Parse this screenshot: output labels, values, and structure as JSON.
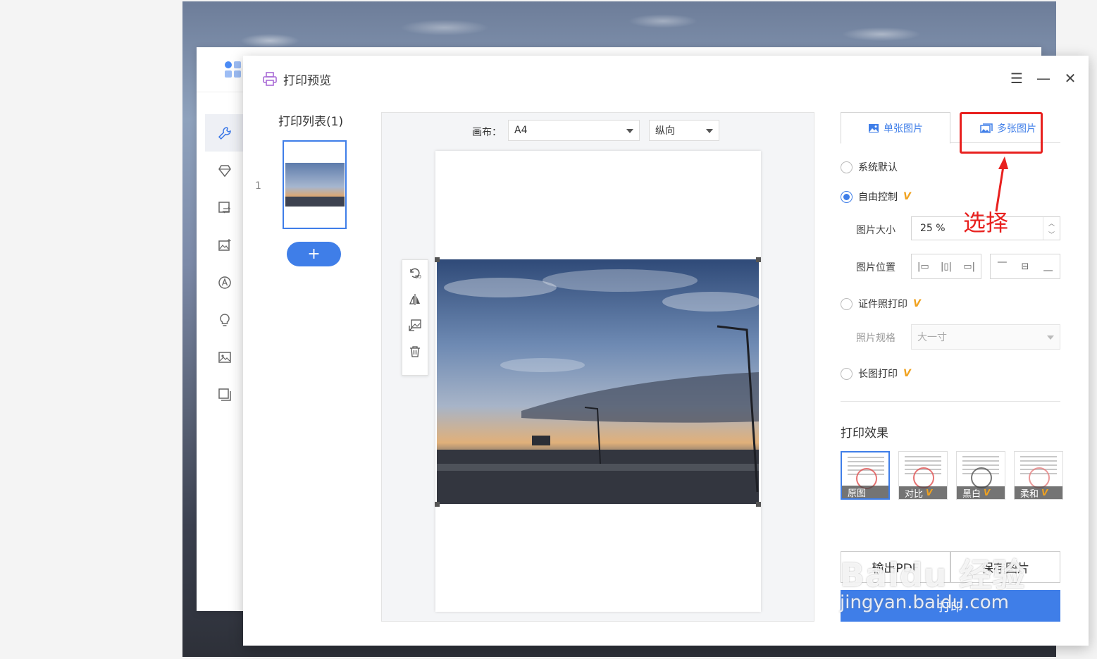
{
  "dialog": {
    "title": "打印预览",
    "controls": {
      "menu": "☰",
      "minimize": "—",
      "close": "✕"
    }
  },
  "print_list": {
    "title": "打印列表(1)",
    "item_index": "1",
    "add_label": "+"
  },
  "preview": {
    "canvas_label": "画布：",
    "paper_size": "A4",
    "orientation": "纵向",
    "tools": [
      "rotate-90-icon",
      "flip-icon",
      "replace-image-icon",
      "delete-icon"
    ]
  },
  "panel": {
    "tabs": {
      "single": "单张图片",
      "multi": "多张图片"
    },
    "options": {
      "system_default": "系统默认",
      "free_control": "自由控制",
      "id_photo": "证件照打印",
      "long_image": "长图打印"
    },
    "vip_mark": "V",
    "image_size_label": "图片大小",
    "image_size_value": "25 %",
    "image_position_label": "图片位置",
    "photo_spec_label": "照片规格",
    "photo_spec_value": "大一寸",
    "effect_title": "打印效果",
    "effects": {
      "original": "原图",
      "contrast": "对比",
      "bw": "黑白",
      "soft": "柔和"
    },
    "export_pdf": "输出PDF",
    "save_image": "保存图片",
    "print": "打印"
  },
  "annotation": {
    "text": "选择",
    "color": "#e8211f"
  },
  "watermark": {
    "line1": "Baidu 经验",
    "line2": "jingyan.baidu.com"
  },
  "colors": {
    "accent": "#3f7ee8",
    "vip": "#f0a21f",
    "highlight": "#e8211f"
  }
}
